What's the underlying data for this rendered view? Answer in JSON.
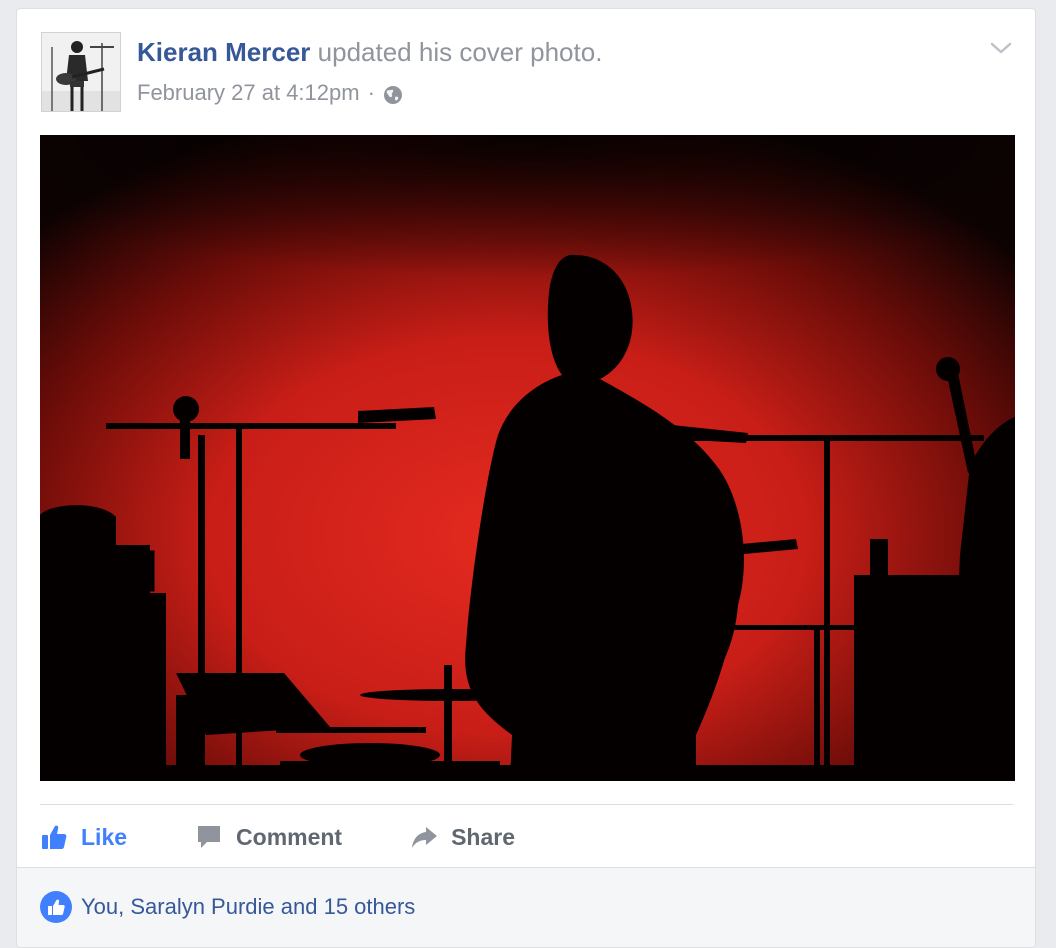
{
  "post": {
    "author": "Kieran Mercer",
    "action_text": "updated his cover photo.",
    "timestamp": "February 27 at 4:12pm",
    "separator": "·",
    "privacy_icon": "globe-icon",
    "menu_icon": "chevron-down-icon",
    "photo_description_icon": "cover-photo"
  },
  "actions": {
    "like_label": "Like",
    "comment_label": "Comment",
    "share_label": "Share"
  },
  "reactions": {
    "summary": "You, Saralyn Purdie and 15 others",
    "icon": "like-badge-icon"
  },
  "colors": {
    "link": "#365899",
    "like_accent": "#4080ff",
    "muted": "#90949c",
    "background": "#e9ebee"
  }
}
